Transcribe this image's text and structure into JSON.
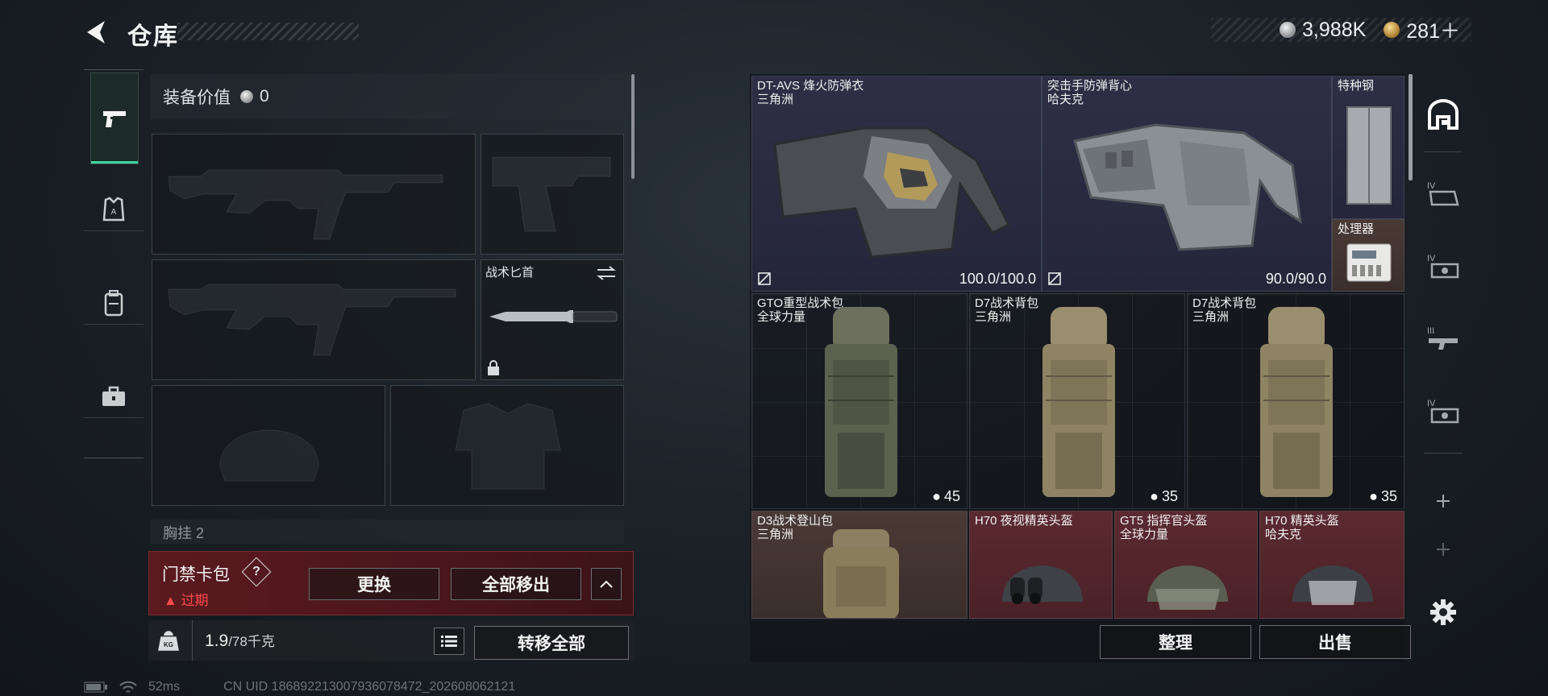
{
  "header": {
    "title": "仓库",
    "currencies": [
      {
        "icon": "silver-coin-icon",
        "value": "3,988K"
      },
      {
        "icon": "gold-coin-icon",
        "value": "281＋"
      }
    ]
  },
  "tabs": [
    {
      "name": "tab-weapons",
      "icon": "pistol-icon",
      "active": true
    },
    {
      "name": "tab-equipment",
      "icon": "armor-icon",
      "active": false
    },
    {
      "name": "tab-backpack",
      "icon": "backpack-icon",
      "active": false
    },
    {
      "name": "tab-toolbox",
      "icon": "toolbox-icon",
      "active": false
    }
  ],
  "loadout": {
    "value_label": "装备价值",
    "value": "0",
    "knife_label": "战术匕首",
    "chest_label": "胸挂",
    "chest_count": "2"
  },
  "keycard": {
    "title": "门禁卡包",
    "help": "?",
    "status": "过期",
    "replace_button": "更换",
    "remove_all_button": "全部移出"
  },
  "weight": {
    "current": "1.9",
    "capacity": "/78千克",
    "transfer_all_button": "转移全部"
  },
  "stash_items": [
    {
      "name": "DT-AVS 烽火防弹衣",
      "sub": "三角洲",
      "value": "100.0/100.0",
      "tier": "blue"
    },
    {
      "name": "突击手防弹背心",
      "sub": "哈夫克",
      "value": "90.0/90.0",
      "tier": "blue"
    },
    {
      "name": "特种钢",
      "sub": "",
      "value": "",
      "tier": "blue"
    },
    {
      "name": "处理器",
      "sub": "",
      "value": "",
      "tier": "brown"
    },
    {
      "name": "GTO重型战术包",
      "sub": "全球力量",
      "capacity": "45",
      "tier": "red"
    },
    {
      "name": "D7战术背包",
      "sub": "三角洲",
      "capacity": "35",
      "tier": "red"
    },
    {
      "name": "D7战术背包",
      "sub": "三角洲",
      "capacity": "35",
      "tier": "red"
    },
    {
      "name": "D3战术登山包",
      "sub": "三角洲",
      "tier": "brown"
    },
    {
      "name": "H70 夜视精英头盔",
      "sub": "",
      "tier": "red"
    },
    {
      "name": "GT5 指挥官头盔",
      "sub": "全球力量",
      "tier": "red"
    },
    {
      "name": "H70 精英头盔",
      "sub": "哈夫克",
      "tier": "red"
    }
  ],
  "actions": {
    "sort_button": "整理",
    "sell_button": "出售"
  },
  "filters": {
    "labels": [
      "IV",
      "IV",
      "III",
      "IV"
    ]
  },
  "footer": {
    "ping": "52ms",
    "uid": "CN UID 1868922130079360784​72_202608062121"
  },
  "colors": {
    "accent": "#3fd6a0",
    "expired": "#ff4a4a",
    "tier_red": "#5b2a30",
    "tier_blue": "#2e2f45"
  }
}
